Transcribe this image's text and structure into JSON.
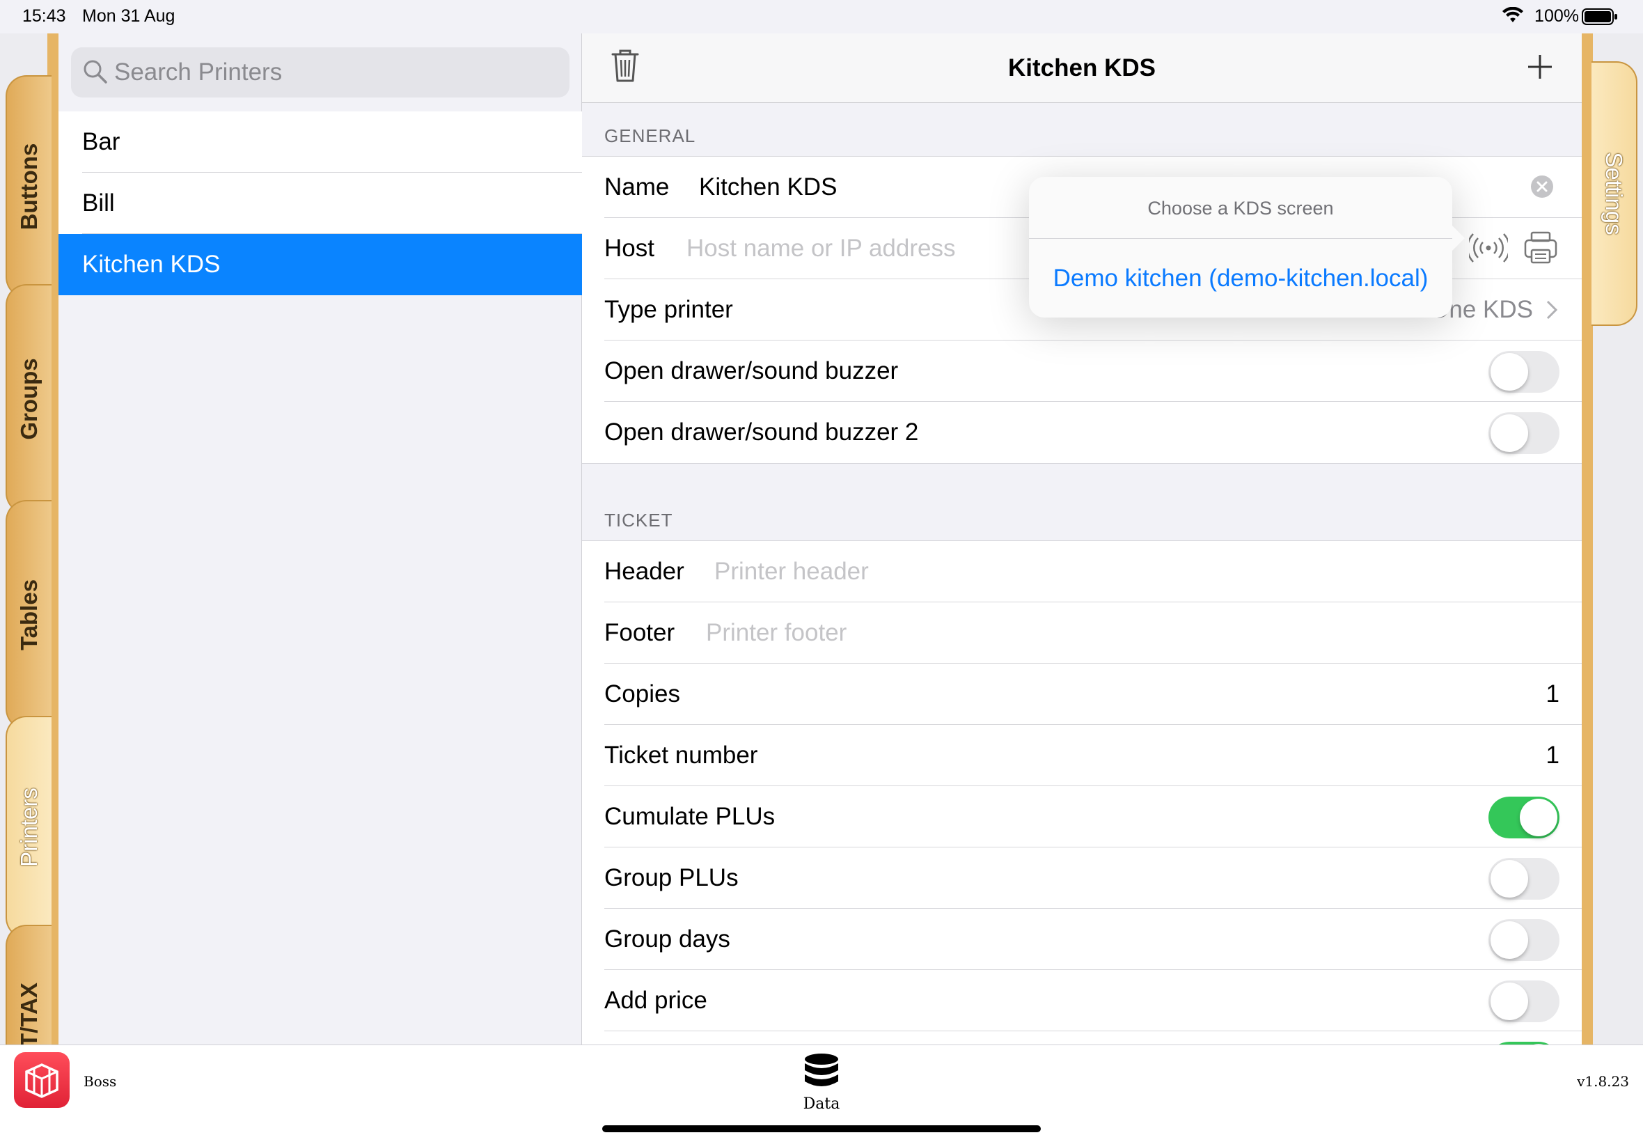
{
  "status_bar": {
    "time": "15:43",
    "date": "Mon 31 Aug",
    "battery": "100%"
  },
  "left_tabs": [
    {
      "label": "Buttons",
      "active": false
    },
    {
      "label": "Groups",
      "active": false
    },
    {
      "label": "Tables",
      "active": false
    },
    {
      "label": "Printers",
      "active": true
    },
    {
      "label": "VAT/TAX",
      "active": false
    }
  ],
  "right_tabs": [
    {
      "label": "Settings"
    }
  ],
  "search": {
    "placeholder": "Search Printers"
  },
  "printers": [
    {
      "name": "Bar",
      "selected": false
    },
    {
      "name": "Bill",
      "selected": false
    },
    {
      "name": "Kitchen KDS",
      "selected": true
    }
  ],
  "detail": {
    "title": "Kitchen KDS",
    "general": {
      "header": "GENERAL",
      "name_label": "Name",
      "name_value": "Kitchen KDS",
      "host_label": "Host",
      "host_placeholder": "Host name or IP address",
      "type_label": "Type printer",
      "type_value": "One KDS",
      "drawer_label": "Open drawer/sound buzzer",
      "drawer_on": false,
      "drawer2_label": "Open drawer/sound buzzer 2",
      "drawer2_on": false
    },
    "ticket": {
      "header": "TICKET",
      "header_label": "Header",
      "header_placeholder": "Printer header",
      "footer_label": "Footer",
      "footer_placeholder": "Printer footer",
      "copies_label": "Copies",
      "copies_value": "1",
      "ticket_number_label": "Ticket number",
      "ticket_number_value": "1",
      "cumulate_label": "Cumulate PLUs",
      "cumulate_on": true,
      "group_plus_label": "Group PLUs",
      "group_plus_on": false,
      "group_days_label": "Group days",
      "group_days_on": false,
      "add_price_label": "Add price",
      "add_price_on": false
    }
  },
  "popover": {
    "title": "Choose a KDS screen",
    "options": [
      "Demo kitchen (demo-kitchen.local)"
    ]
  },
  "bottom_bar": {
    "app_name": "Boss",
    "data_label": "Data",
    "version": "v1.8.23"
  },
  "colors": {
    "accent": "#0a84ff",
    "toggle_on": "#34c759",
    "tab_gold": "#e6b565",
    "app_icon": "#e8303f"
  }
}
